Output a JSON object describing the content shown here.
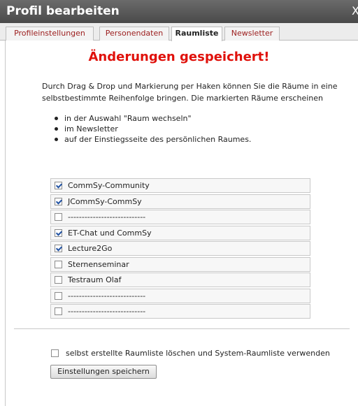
{
  "dialog": {
    "title": "Profil bearbeiten",
    "close": "X"
  },
  "tabs": [
    {
      "label": "Profileinstellungen",
      "active": false
    },
    {
      "label": "Personendaten",
      "active": false
    },
    {
      "label": "Raumliste",
      "active": true
    },
    {
      "label": "Newsletter",
      "active": false
    }
  ],
  "status_message": "Änderungen gespeichert!",
  "description": "Durch Drag & Drop und Markierung per Haken können Sie die Räume in eine selbstbestimmte Reihenfolge bringen. Die markierten Räume erscheinen",
  "bullets": [
    "in der Auswahl \"Raum wechseln\"",
    "im Newsletter",
    "auf der Einstiegsseite des persönlichen Raumes."
  ],
  "rooms": [
    {
      "label": "CommSy-Community",
      "checked": true
    },
    {
      "label": "JCommSy-CommSy",
      "checked": true
    },
    {
      "label": "----------------------------",
      "checked": false
    },
    {
      "label": "ET-Chat und CommSy",
      "checked": true
    },
    {
      "label": "Lecture2Go",
      "checked": true
    },
    {
      "label": "Sternenseminar",
      "checked": false
    },
    {
      "label": "Testraum Olaf",
      "checked": false
    },
    {
      "label": "----------------------------",
      "checked": false
    },
    {
      "label": "----------------------------",
      "checked": false
    }
  ],
  "reset_option": {
    "label": "selbst erstellte Raumliste löschen und System-Raumliste verwenden",
    "checked": false
  },
  "save_button": "Einstellungen speichern",
  "colors": {
    "title_bar": "#555555",
    "tab_text": "#9b1c1c",
    "status": "#e0110b",
    "check": "#2253a3"
  }
}
